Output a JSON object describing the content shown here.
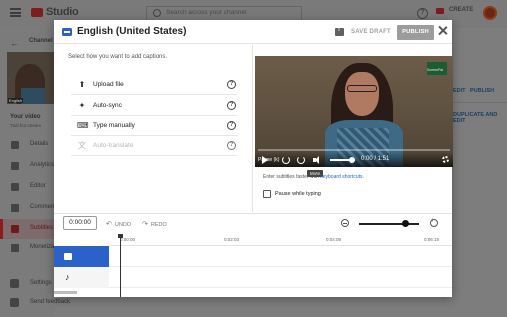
{
  "background": {
    "app_name": "Studio",
    "search_placeholder": "Search across your channel",
    "help_icon": "help-icon",
    "create_label": "CREATE",
    "channel_label": "Channel c",
    "thumb_tag": "English",
    "your_video_title": "Your video",
    "your_video_subtitle": "Trial bot stream",
    "nav": [
      {
        "label": "Details",
        "icon": "pencil-icon"
      },
      {
        "label": "Analytics",
        "icon": "analytics-icon"
      },
      {
        "label": "Editor",
        "icon": "editor-icon"
      },
      {
        "label": "Comments",
        "icon": "comments-icon"
      },
      {
        "label": "Subtitles",
        "icon": "subtitles-icon",
        "active": true
      },
      {
        "label": "Monetization",
        "icon": "dollar-icon"
      }
    ],
    "settings_label": "Settings",
    "feedback_label": "Send feedback",
    "edit_label": "EDIT",
    "publish_label": "PUBLISH",
    "duplicate_label": "DUPLICATE AND EDIT"
  },
  "modal": {
    "title": "English (United States)",
    "save_draft_label": "SAVE DRAFT",
    "publish_label": "PUBLISH",
    "instruction": "Select how you want to add captions.",
    "options": [
      {
        "label": "Upload file",
        "icon": "upload-icon",
        "icon_glyph": "⬆",
        "disabled": false
      },
      {
        "label": "Auto-sync",
        "icon": "auto-sync-icon",
        "icon_glyph": "✦",
        "disabled": false
      },
      {
        "label": "Type manually",
        "icon": "keyboard-icon",
        "icon_glyph": "⌨",
        "disabled": false
      },
      {
        "label": "Auto-translate",
        "icon": "translate-icon",
        "icon_glyph": "文",
        "disabled": true
      }
    ],
    "help_glyph": "?",
    "video": {
      "play_label": "Pause (k)",
      "time_display": "0:00 / 1:51",
      "tooltip": "Mute",
      "watermark": "ScreenPal"
    },
    "shortcut_prefix": "Enter subtitles faster with ",
    "shortcut_link": "keyboard shortcuts.",
    "pause_while_typing": "Pause while typing",
    "toolbar": {
      "time_value": "0:00:00",
      "undo_label": "UNDO",
      "redo_label": "REDO",
      "undo_glyph": "↶",
      "redo_glyph": "↷"
    },
    "timeline": {
      "ticks": [
        "0:00:00",
        "0:02:03",
        "0:04:08",
        "0:06:15"
      ]
    },
    "music_glyph": "♪"
  }
}
